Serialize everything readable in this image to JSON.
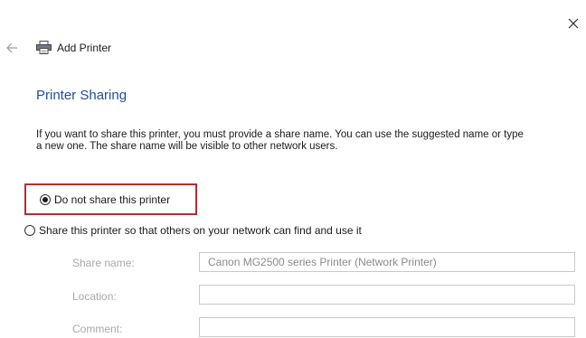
{
  "window": {
    "title": "Add Printer",
    "close_icon": "close-icon",
    "back_icon": "back-arrow-icon",
    "printer_icon": "printer-icon"
  },
  "page": {
    "heading": "Printer Sharing",
    "description_line1": "If you want to share this printer, you must provide a share name. You can use the suggested name or type",
    "description_line2": "a new one. The share name will be visible to other network users."
  },
  "sharing_options": [
    {
      "label": "Do not share this printer",
      "selected": true
    },
    {
      "label": "Share this printer so that others on your network can find and use it",
      "selected": false
    }
  ],
  "fields": {
    "share_name": {
      "label": "Share name:",
      "value": "Canon MG2500 series Printer (Network Printer)"
    },
    "location": {
      "label": "Location:",
      "value": ""
    },
    "comment": {
      "label": "Comment:",
      "value": ""
    }
  },
  "colors": {
    "heading": "#1f4e9c",
    "highlight": "#b22f2f",
    "disabled_text": "#a8a8a8"
  }
}
